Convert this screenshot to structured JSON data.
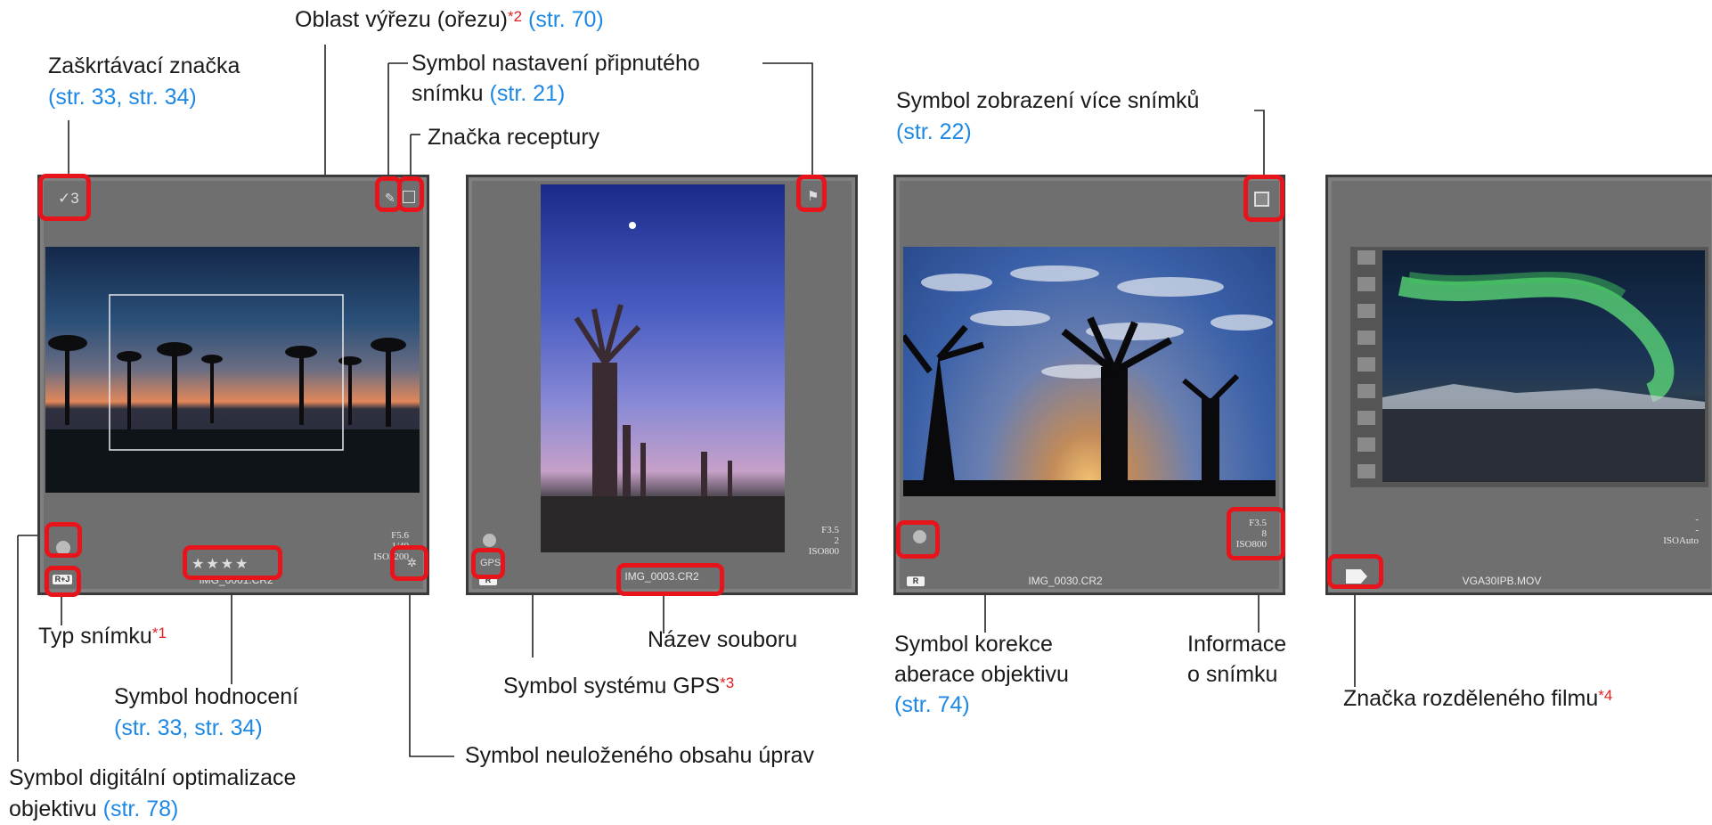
{
  "labels": {
    "crop_area": "Oblast výřezu (ořezu)",
    "crop_area_note": "*2",
    "crop_area_ref": "(str. 70)",
    "checkmark": "Zaškrtávací značka",
    "checkmark_ref": "(str. 33, str. 34)",
    "pinned_symbol_1": "Symbol nastavení připnutého",
    "pinned_symbol_2": "snímku",
    "pinned_symbol_ref": "(str. 21)",
    "recipe_mark": "Značka receptury",
    "multi_image_symbol": "Symbol zobrazení více snímků",
    "multi_image_ref": "(str. 22)",
    "image_type": "Typ snímku",
    "image_type_note": "*1",
    "rating_symbol": "Symbol hodnocení",
    "rating_ref": "(str. 33, str. 34)",
    "dlo_symbol_1": "Symbol digitální optimalizace",
    "dlo_symbol_2": "objektivu",
    "dlo_ref": "(str. 78)",
    "unsaved_edits": "Symbol neuloženého obsahu úprav",
    "file_name": "Název souboru",
    "gps_symbol": "Symbol systému GPS",
    "gps_note": "*3",
    "aberration_1": "Symbol korekce",
    "aberration_2": "aberace objektivu",
    "aberration_ref": "(str. 74)",
    "info_1": "Informace",
    "info_2": "o snímku",
    "split_movie": "Značka rozděleného filmu",
    "split_movie_note": "*4"
  },
  "thumbnails": [
    {
      "filename": "IMG_0001.CR2",
      "check": "✓3",
      "info": [
        "F5.6",
        "1/40",
        "ISO3200"
      ],
      "badge": "R+J",
      "rating": "★★★★"
    },
    {
      "filename": "IMG_0003.CR2",
      "info": [
        "F3.5",
        "2",
        "ISO800"
      ],
      "badge": "R",
      "gps": "GPS"
    },
    {
      "filename": "IMG_0030.CR2",
      "info": [
        "F3.5",
        "8",
        "ISO800"
      ],
      "badge": "R"
    },
    {
      "filename": "VGA30IPB.MOV",
      "info": [
        "-",
        "-",
        "ISOAuto"
      ]
    }
  ],
  "colors": {
    "highlight": "#e8141b",
    "reference": "#1e88e5",
    "note": "#e02020"
  }
}
